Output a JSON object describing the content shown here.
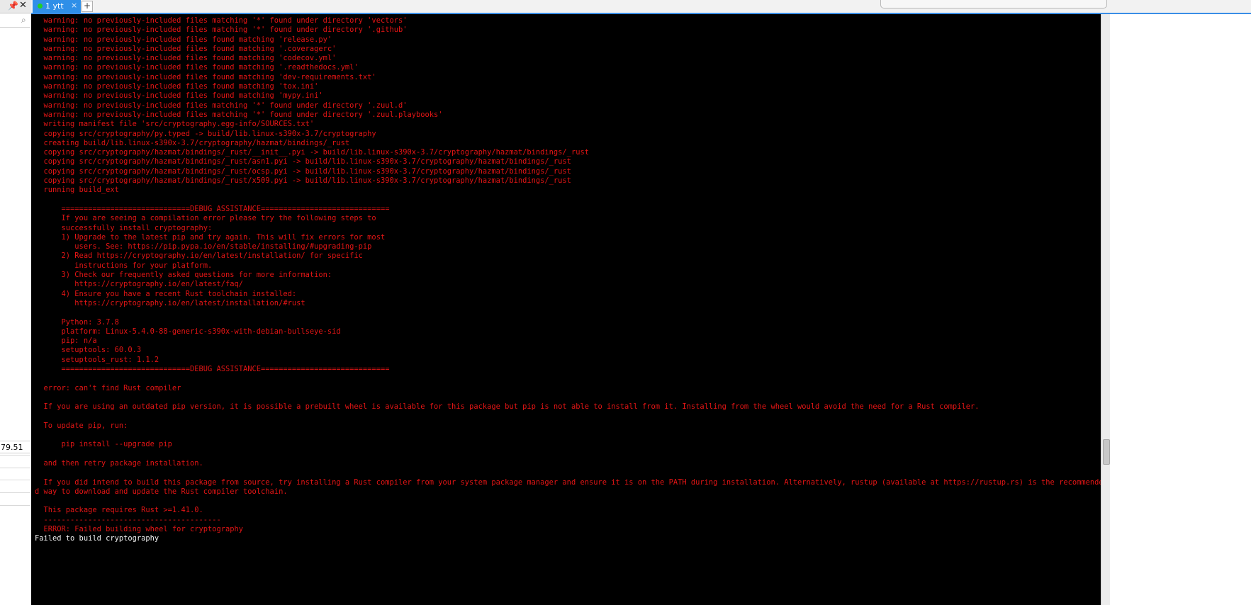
{
  "left_panel": {
    "pin_icon": "pin-icon",
    "close_icon": "close-icon",
    "search_icon": "search-icon",
    "value": "79.51"
  },
  "tabs": [
    {
      "label": "1 ytt",
      "close": "×",
      "status_color": "#22d022"
    }
  ],
  "add_tab_label": "+",
  "colors": {
    "terminal_bg": "#000000",
    "terminal_text": "#e31515",
    "accent": "#2f8fe8"
  },
  "terminal": {
    "lines": [
      "  warning: no previously-included files matching '*' found under directory 'vectors'",
      "  warning: no previously-included files matching '*' found under directory '.github'",
      "  warning: no previously-included files found matching 'release.py'",
      "  warning: no previously-included files found matching '.coveragerc'",
      "  warning: no previously-included files found matching 'codecov.yml'",
      "  warning: no previously-included files found matching '.readthedocs.yml'",
      "  warning: no previously-included files found matching 'dev-requirements.txt'",
      "  warning: no previously-included files found matching 'tox.ini'",
      "  warning: no previously-included files found matching 'mypy.ini'",
      "  warning: no previously-included files matching '*' found under directory '.zuul.d'",
      "  warning: no previously-included files matching '*' found under directory '.zuul.playbooks'",
      "  writing manifest file 'src/cryptography.egg-info/SOURCES.txt'",
      "  copying src/cryptography/py.typed -> build/lib.linux-s390x-3.7/cryptography",
      "  creating build/lib.linux-s390x-3.7/cryptography/hazmat/bindings/_rust",
      "  copying src/cryptography/hazmat/bindings/_rust/__init__.pyi -> build/lib.linux-s390x-3.7/cryptography/hazmat/bindings/_rust",
      "  copying src/cryptography/hazmat/bindings/_rust/asn1.pyi -> build/lib.linux-s390x-3.7/cryptography/hazmat/bindings/_rust",
      "  copying src/cryptography/hazmat/bindings/_rust/ocsp.pyi -> build/lib.linux-s390x-3.7/cryptography/hazmat/bindings/_rust",
      "  copying src/cryptography/hazmat/bindings/_rust/x509.pyi -> build/lib.linux-s390x-3.7/cryptography/hazmat/bindings/_rust",
      "  running build_ext",
      "",
      "      =============================DEBUG ASSISTANCE=============================",
      "      If you are seeing a compilation error please try the following steps to",
      "      successfully install cryptography:",
      "      1) Upgrade to the latest pip and try again. This will fix errors for most",
      "         users. See: https://pip.pypa.io/en/stable/installing/#upgrading-pip",
      "      2) Read https://cryptography.io/en/latest/installation/ for specific",
      "         instructions for your platform.",
      "      3) Check our frequently asked questions for more information:",
      "         https://cryptography.io/en/latest/faq/",
      "      4) Ensure you have a recent Rust toolchain installed:",
      "         https://cryptography.io/en/latest/installation/#rust",
      "",
      "      Python: 3.7.8",
      "      platform: Linux-5.4.0-88-generic-s390x-with-debian-bullseye-sid",
      "      pip: n/a",
      "      setuptools: 60.0.3",
      "      setuptools_rust: 1.1.2",
      "      =============================DEBUG ASSISTANCE=============================",
      "",
      "  error: can't find Rust compiler",
      "",
      "  If you are using an outdated pip version, it is possible a prebuilt wheel is available for this package but pip is not able to install from it. Installing from the wheel would avoid the need for a Rust compiler.",
      "",
      "  To update pip, run:",
      "",
      "      pip install --upgrade pip",
      "",
      "  and then retry package installation.",
      "",
      "  If you did intend to build this package from source, try installing a Rust compiler from your system package manager and ensure it is on the PATH during installation. Alternatively, rustup (available at https://rustup.rs) is the recommende",
      "d way to download and update the Rust compiler toolchain.",
      "",
      "  This package requires Rust >=1.41.0.",
      "  ----------------------------------------",
      "  ERROR: Failed building wheel for cryptography",
      "Failed to build cryptography"
    ]
  }
}
